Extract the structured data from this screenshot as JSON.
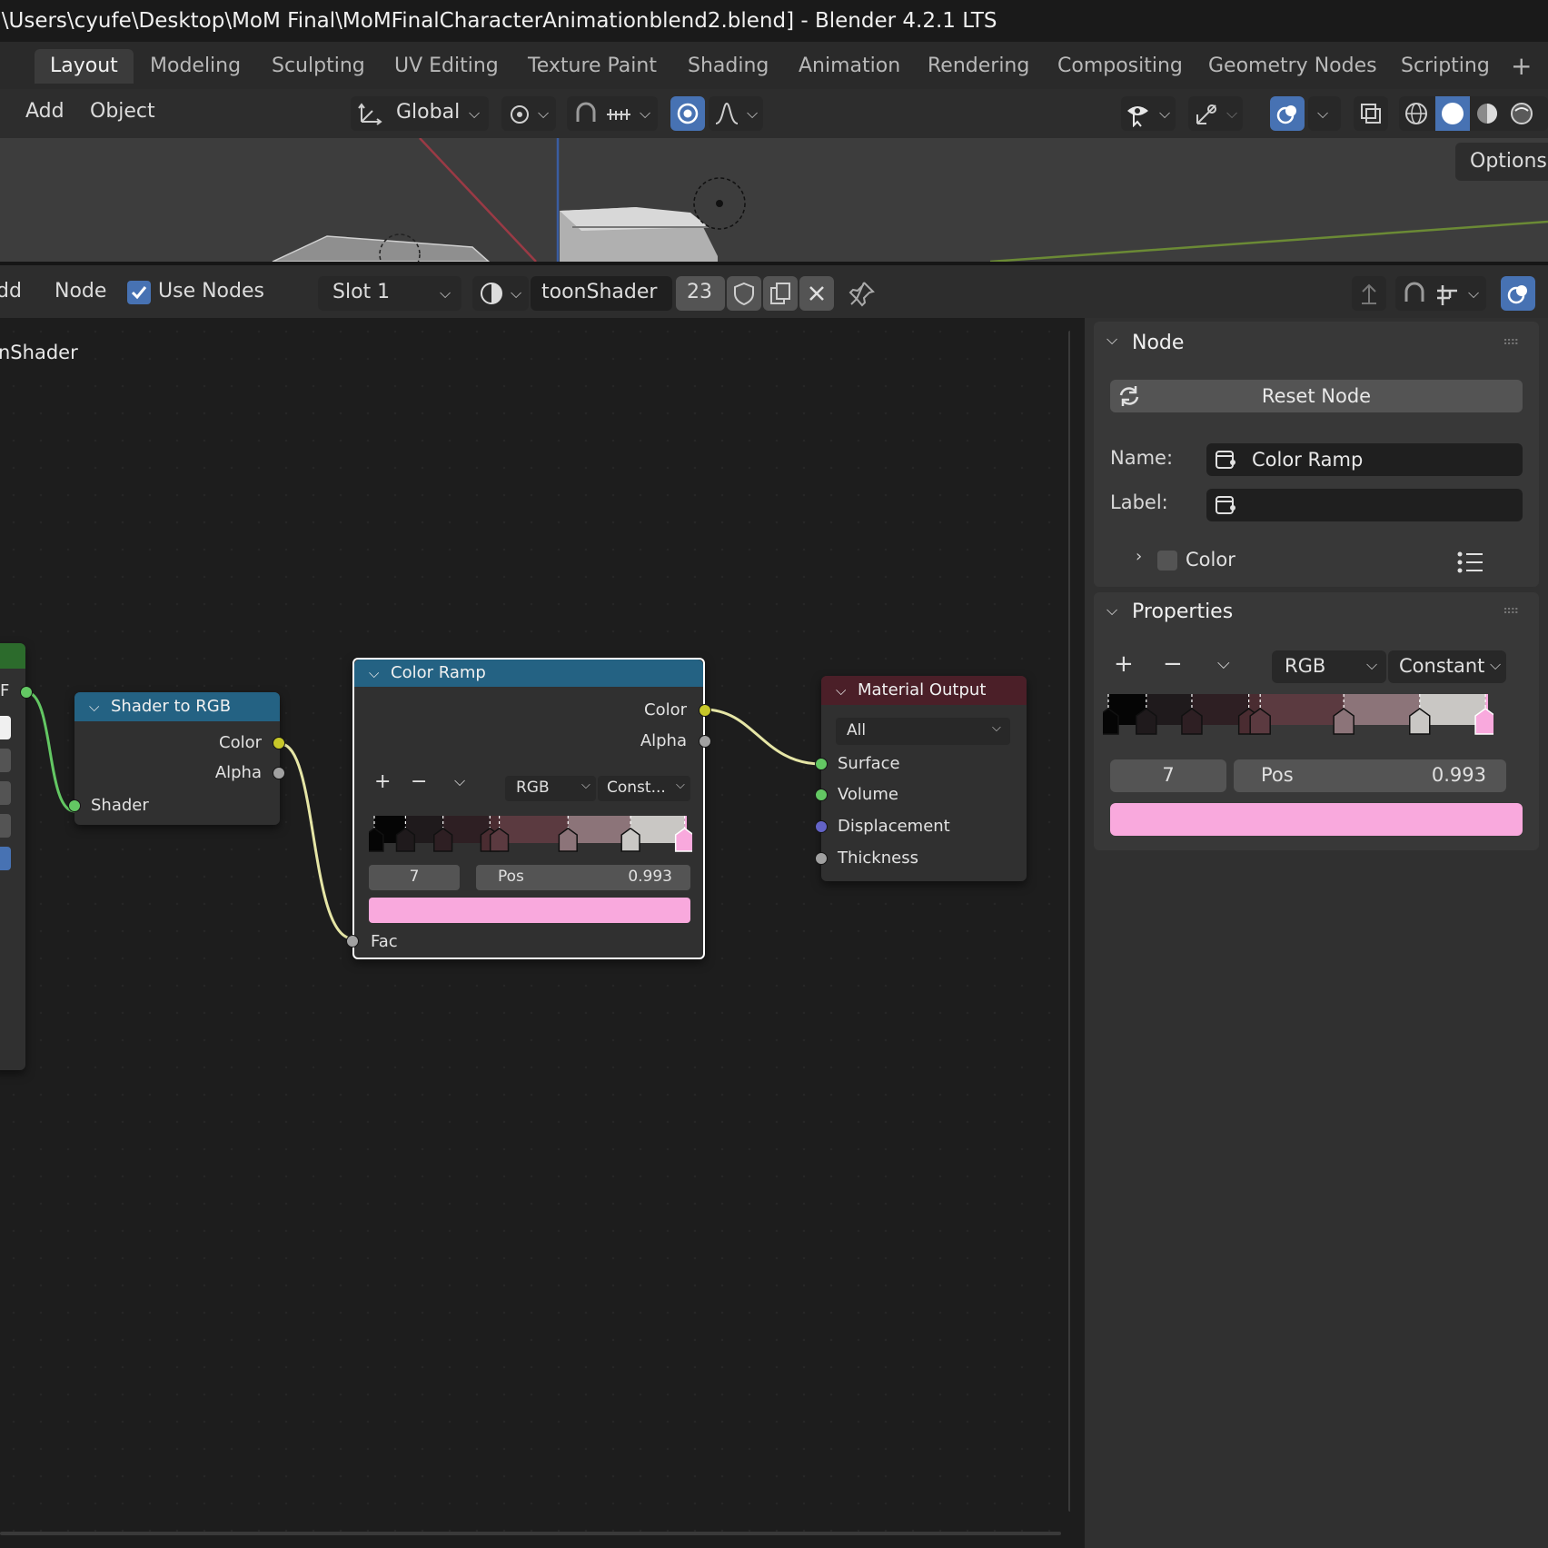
{
  "window": {
    "title": ":\\Users\\cyufe\\Desktop\\MoM Final\\MoMFinalCharacterAnimationblend2.blend] - Blender 4.2.1 LTS"
  },
  "workspace_tabs": [
    "Layout",
    "Modeling",
    "Sculpting",
    "UV Editing",
    "Texture Paint",
    "Shading",
    "Animation",
    "Rendering",
    "Compositing",
    "Geometry Nodes",
    "Scripting"
  ],
  "workspace_add": "+",
  "viewport_header": {
    "menus": [
      "Add",
      "Object"
    ],
    "transform_orientation": "Global",
    "options_label": "Options"
  },
  "node_header": {
    "menus": [
      "dd",
      "Node"
    ],
    "use_nodes_label": "Use Nodes",
    "use_nodes_checked": true,
    "slot": "Slot 1",
    "material_name": "toonShader",
    "user_count": "23"
  },
  "breadcrumb": "nShader",
  "partial_node": {
    "socket_label": "F"
  },
  "nodes": {
    "shader_to_rgb": {
      "title": "Shader to RGB",
      "outputs": [
        "Color",
        "Alpha"
      ],
      "inputs": [
        "Shader"
      ]
    },
    "color_ramp": {
      "title": "Color Ramp",
      "outputs": [
        "Color",
        "Alpha"
      ],
      "color_mode": "RGB",
      "interpolation": "Const...",
      "active_index": "7",
      "pos_label": "Pos",
      "pos_value": "0.993",
      "input": "Fac"
    },
    "material_output": {
      "title": "Material Output",
      "target": "All",
      "inputs": [
        "Surface",
        "Volume",
        "Displacement",
        "Thickness"
      ]
    }
  },
  "sidebar": {
    "node_panel": {
      "title": "Node",
      "reset_label": "Reset Node",
      "name_label": "Name:",
      "name_value": "Color Ramp",
      "label_label": "Label:",
      "label_value": "",
      "color_label": "Color"
    },
    "properties_panel": {
      "title": "Properties",
      "color_mode": "RGB",
      "interpolation": "Constant",
      "active_index": "7",
      "pos_label": "Pos",
      "pos_value": "0.993"
    }
  },
  "ramp": {
    "interpolation": "constant",
    "stops": [
      {
        "pos": 0.0,
        "color": "#050505"
      },
      {
        "pos": 0.1,
        "color": "#1f1a1c"
      },
      {
        "pos": 0.22,
        "color": "#2e1f23"
      },
      {
        "pos": 0.37,
        "color": "#4a2c31"
      },
      {
        "pos": 0.4,
        "color": "#5b3a40"
      },
      {
        "pos": 0.62,
        "color": "#8c7479"
      },
      {
        "pos": 0.82,
        "color": "#c9c7c4"
      },
      {
        "pos": 0.993,
        "color": "#f9a9dd"
      }
    ],
    "active_color": "#f9a9dd"
  },
  "colors": {
    "accent_blue": "#4772b3",
    "node_header_blue": "#246283",
    "node_header_red": "#4b1f28",
    "socket_shader": "#63c763",
    "socket_color": "#c7c729",
    "socket_float": "#a1a1a1",
    "socket_vector": "#6363c7",
    "link_yellow": "#e6e6a6",
    "link_green": "#63c763"
  }
}
